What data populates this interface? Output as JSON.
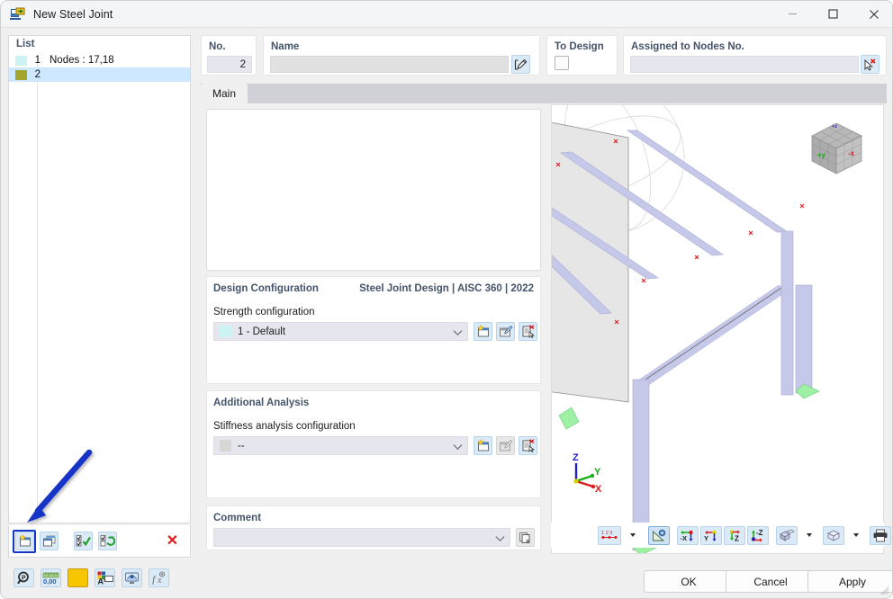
{
  "window": {
    "title": "New Steel Joint",
    "icon": "steel-joint-icon",
    "minimize": "—",
    "maximize": "☐",
    "close": "✕"
  },
  "left_panel": {
    "header": "List",
    "rows": [
      {
        "index": "1",
        "label": "Nodes : 17,18",
        "swatch": "#cdf4f4",
        "selected": false
      },
      {
        "index": "2",
        "label": "",
        "swatch": "#a3a52c",
        "selected": true
      }
    ],
    "toolbar": [
      {
        "name": "new-joint-button",
        "title": "New",
        "highlighted": true
      },
      {
        "name": "copy-joint-button",
        "title": "Copy"
      },
      {
        "name": "select-all-button",
        "title": "Select All"
      },
      {
        "name": "invert-selection-button",
        "title": "Invert Selection"
      },
      {
        "name": "delete-joint-button",
        "title": "Delete",
        "glyph": "✕"
      }
    ]
  },
  "header_cards": {
    "no": {
      "label": "No.",
      "value": "2"
    },
    "name": {
      "label": "Name",
      "value": "",
      "edit_button": "name-edit-button"
    },
    "to_design": {
      "label": "To Design",
      "checked": false
    },
    "assigned": {
      "label": "Assigned to Nodes No.",
      "value": "",
      "pick_button": "pick-nodes-button"
    }
  },
  "tabs": [
    {
      "label": "Main",
      "active": true
    }
  ],
  "design_configuration": {
    "group_label": "Design Configuration",
    "standard": "Steel Joint Design | AISC 360 | 2022",
    "field_label": "Strength configuration",
    "value": "1 - Default",
    "swatch": "#cdf4f4",
    "buttons": [
      "new-config-button",
      "edit-config-button",
      "delete-config-button"
    ]
  },
  "additional_analysis": {
    "group_label": "Additional Analysis",
    "field_label": "Stiffness analysis configuration",
    "value": "--",
    "swatch": "#d6d6d6",
    "buttons": [
      "new-stiffness-config-button",
      "edit-stiffness-config-button",
      "delete-stiffness-config-button"
    ]
  },
  "comment": {
    "group_label": "Comment",
    "value": "",
    "button": "comment-library-button"
  },
  "viewport": {
    "nav_cube": {
      "label_y": "+y",
      "label_x": "-x"
    },
    "axes": {
      "z": "Z",
      "y": "Y",
      "x": "X"
    },
    "toolbar": [
      {
        "name": "numbering-button",
        "label": "1 2 3",
        "dropdown": true
      },
      {
        "name": "render-mode-button",
        "active": true
      },
      {
        "name": "view-in-minus-x-button",
        "label": "-X"
      },
      {
        "name": "view-in-y-button",
        "label": "Y"
      },
      {
        "name": "view-in-z-button",
        "label": "Z"
      },
      {
        "name": "view-in-minus-z-button",
        "label": "-Z"
      },
      {
        "name": "display-model-button",
        "dropdown": true
      },
      {
        "name": "wireframe-button",
        "dropdown": true
      },
      {
        "name": "print-button",
        "dropdown": true
      },
      {
        "name": "zoom-reset-button"
      }
    ]
  },
  "footer": {
    "toolbar": [
      {
        "name": "search-icon-button",
        "title": "Find"
      },
      {
        "name": "decimal-places-button",
        "title": "0,00",
        "label": "0,00"
      },
      {
        "name": "color-swatch-button",
        "title": "Colors",
        "color": "#f7c600"
      },
      {
        "name": "font-color-button",
        "title": "Font"
      },
      {
        "name": "display-settings-button",
        "title": "Display"
      },
      {
        "name": "formula-button",
        "title": "Formula",
        "label": "fₓ"
      }
    ],
    "buttons": [
      {
        "name": "ok-button",
        "label": "OK"
      },
      {
        "name": "cancel-button",
        "label": "Cancel"
      },
      {
        "name": "apply-button",
        "label": "Apply"
      }
    ]
  },
  "colors": {
    "accent_blue": "#44546a",
    "annotation_arrow": "#1436c8",
    "highlight_row": "#cde8ff",
    "member_blue": "#c5c8e8",
    "support_green": "#9ef0a4",
    "delete_red": "#e01b1b"
  }
}
